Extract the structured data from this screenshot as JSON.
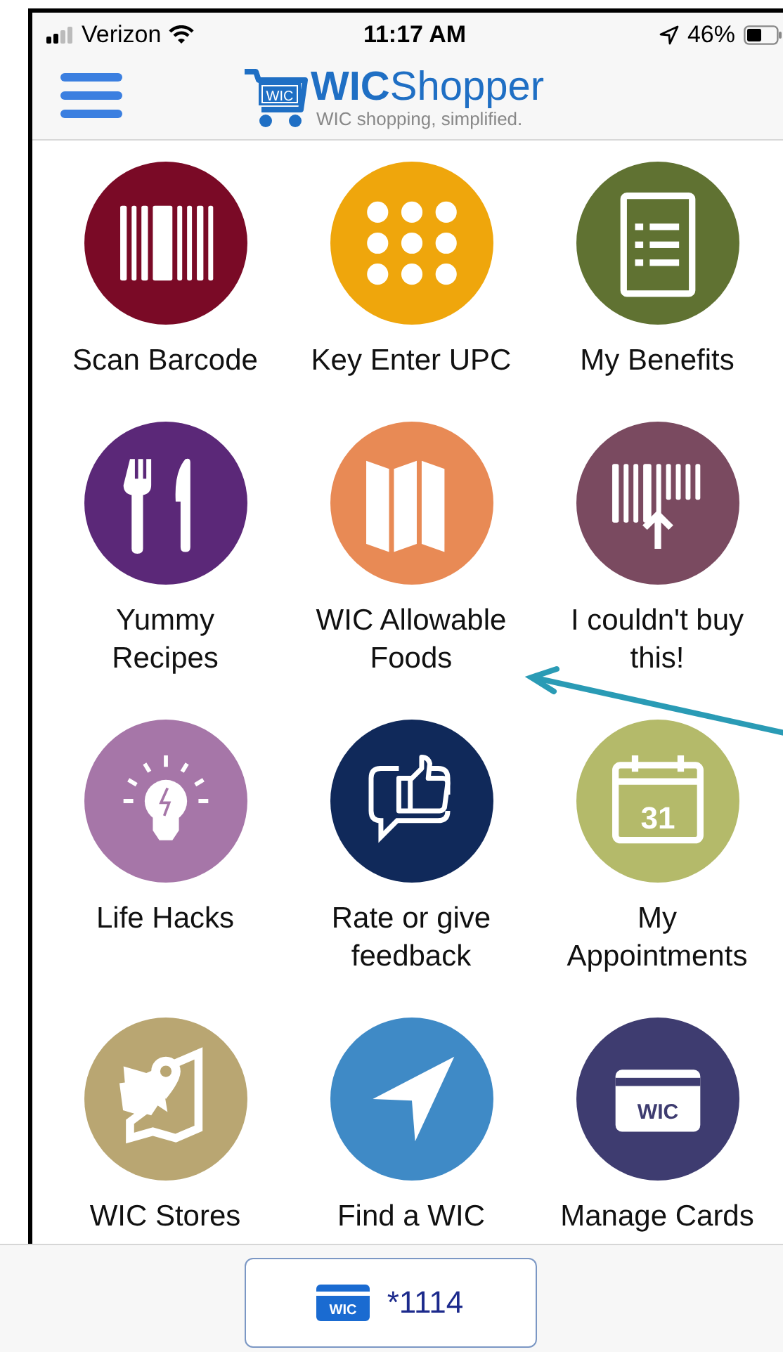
{
  "status_bar": {
    "carrier": "Verizon",
    "time": "11:17 AM",
    "battery": "46%"
  },
  "header": {
    "logo_badge": "WIC",
    "title": "**WIC**Shopper",
    "tagline": "WIC shopping, simplified."
  },
  "tiles": [
    {
      "kind": "barcode",
      "label": "Scan Barcode",
      "color": "#7a0a26"
    },
    {
      "kind": "keypad",
      "label": "Key Enter UPC",
      "color": "#efa60c"
    },
    {
      "kind": "list",
      "label": "My Benefits",
      "color": "#607232"
    },
    {
      "kind": "utensils",
      "label": "Yummy\nRecipes",
      "color": "#5b2878"
    },
    {
      "kind": "map",
      "label": "WIC Allowable\nFoods",
      "color": "#e88a55"
    },
    {
      "kind": "upload",
      "label": "I couldn't buy\nthis!",
      "color": "#7a4a60"
    },
    {
      "kind": "bulb",
      "label": "Life Hacks",
      "color": "#a676a8"
    },
    {
      "kind": "feedback",
      "label": "Rate or give\nfeedback",
      "color": "#10295a"
    },
    {
      "kind": "calendar",
      "label": "My\nAppointments",
      "color": "#b4ba6a",
      "icon_text": "31"
    },
    {
      "kind": "stores",
      "label": "WIC Stores",
      "color": "#b9a672"
    },
    {
      "kind": "navigate",
      "label": "Find a WIC",
      "color": "#3f8ac6"
    },
    {
      "kind": "card",
      "label": "Manage Cards",
      "color": "#3e3c70",
      "icon_text": "WIC"
    }
  ],
  "footer": {
    "card_badge": "WIC",
    "card_number": "*1114"
  }
}
